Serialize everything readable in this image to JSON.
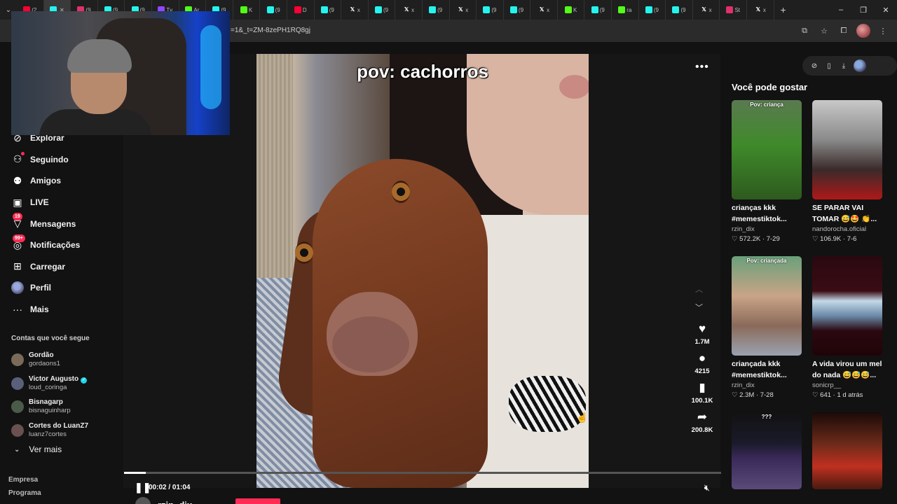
{
  "browser": {
    "tabs": [
      {
        "icon": "youtube-icon",
        "text": "(2",
        "color": "#ff0033"
      },
      {
        "icon": "tiktok-icon",
        "text": "",
        "color": "#25f4ee",
        "active": true,
        "close": "✕"
      },
      {
        "icon": "instagram-icon",
        "text": "(9",
        "color": "#e1306c"
      },
      {
        "icon": "tiktok-icon",
        "text": "(9",
        "color": "#25f4ee"
      },
      {
        "icon": "tiktok-icon",
        "text": "(9",
        "color": "#25f4ee"
      },
      {
        "icon": "twitch-icon",
        "text": "Tv",
        "color": "#9146ff"
      },
      {
        "icon": "kick-icon",
        "text": "Ar",
        "color": "#53fc18"
      },
      {
        "icon": "tiktok-icon",
        "text": "(9",
        "color": "#25f4ee"
      },
      {
        "icon": "kick-icon",
        "text": "K",
        "color": "#53fc18"
      },
      {
        "icon": "tiktok-icon",
        "text": "(9",
        "color": "#25f4ee"
      },
      {
        "icon": "youtube-icon",
        "text": "D",
        "color": "#ff0033"
      },
      {
        "icon": "tiktok-icon",
        "text": "(9",
        "color": "#25f4ee"
      },
      {
        "icon": "x-icon",
        "text": "x",
        "color": "#ffffff"
      },
      {
        "icon": "tiktok-icon",
        "text": "(9",
        "color": "#25f4ee"
      },
      {
        "icon": "x-icon",
        "text": "x",
        "color": "#ffffff"
      },
      {
        "icon": "tiktok-icon",
        "text": "(9",
        "color": "#25f4ee"
      },
      {
        "icon": "x-icon",
        "text": "x",
        "color": "#ffffff"
      },
      {
        "icon": "tiktok-icon",
        "text": "(9",
        "color": "#25f4ee"
      },
      {
        "icon": "tiktok-icon",
        "text": "(9",
        "color": "#25f4ee"
      },
      {
        "icon": "x-icon",
        "text": "x",
        "color": "#ffffff"
      },
      {
        "icon": "kick-icon",
        "text": "K",
        "color": "#53fc18"
      },
      {
        "icon": "tiktok-icon",
        "text": "(9",
        "color": "#25f4ee"
      },
      {
        "icon": "kick-icon",
        "text": "ra",
        "color": "#53fc18"
      },
      {
        "icon": "tiktok-icon",
        "text": "(9",
        "color": "#25f4ee"
      },
      {
        "icon": "tiktok-icon",
        "text": "(9",
        "color": "#25f4ee"
      },
      {
        "icon": "x-icon",
        "text": "x",
        "color": "#ffffff"
      },
      {
        "icon": "instagram-icon",
        "text": "St",
        "color": "#e1306c"
      },
      {
        "icon": "x-icon",
        "text": "x",
        "color": "#ffffff"
      }
    ],
    "new_tab": "+",
    "window_controls": [
      "–",
      "❐",
      "✕"
    ],
    "url": "=1&_t=ZM-8zePH1RQ8gj",
    "addr_icons": [
      "⧉",
      "☆",
      "⧠",
      "",
      "⋮"
    ]
  },
  "sidebar": {
    "nav": [
      {
        "name": "explorar",
        "icon": "compass-icon",
        "glyph": "⊘",
        "label": "Explorar"
      },
      {
        "name": "seguindo",
        "icon": "following-icon",
        "glyph": "⚇",
        "label": "Seguindo",
        "dot": true
      },
      {
        "name": "amigos",
        "icon": "friends-icon",
        "glyph": "⚉",
        "label": "Amigos"
      },
      {
        "name": "live",
        "icon": "live-icon",
        "glyph": "▣",
        "label": "LIVE"
      },
      {
        "name": "mensagens",
        "icon": "messages-icon",
        "glyph": "▽",
        "label": "Mensagens",
        "badge": "19"
      },
      {
        "name": "notificacoes",
        "icon": "notifications-icon",
        "glyph": "◎",
        "label": "Notificações",
        "badge": "99+"
      },
      {
        "name": "carregar",
        "icon": "upload-icon",
        "glyph": "⊞",
        "label": "Carregar"
      },
      {
        "name": "perfil",
        "icon": "profile-icon",
        "glyph": "",
        "label": "Perfil",
        "avatar": true
      },
      {
        "name": "mais",
        "icon": "more-icon",
        "glyph": "···",
        "label": "Mais"
      }
    ],
    "following_title": "Contas que você segue",
    "following": [
      {
        "name": "Gordão",
        "user": "gordaons1",
        "verified": false,
        "color": "#7b6a5a"
      },
      {
        "name": "Victor Augusto",
        "user": "loud_coringa",
        "verified": true,
        "color": "#5a5f7a"
      },
      {
        "name": "Bisnagarp",
        "user": "bisnaguinharp",
        "verified": false,
        "color": "#4b5b4a"
      },
      {
        "name": "Cortes do LuanZ7",
        "user": "luanz7cortes",
        "verified": false,
        "color": "#6a5050"
      }
    ],
    "see_more": "Ver mais",
    "footer": [
      "Empresa",
      "Programa"
    ]
  },
  "player": {
    "caption": "pov: cachorros",
    "more": "•••",
    "prev": "︿",
    "next": "﹀",
    "actions": [
      {
        "name": "like",
        "icon": "heart-icon",
        "glyph": "♥",
        "count": "1.7M"
      },
      {
        "name": "comment",
        "icon": "comment-icon",
        "glyph": "●",
        "count": "4215"
      },
      {
        "name": "save",
        "icon": "bookmark-icon",
        "glyph": "▮",
        "count": "100.1K"
      },
      {
        "name": "share",
        "icon": "share-icon",
        "glyph": "➦",
        "count": "200.8K"
      }
    ],
    "progress": 0.036,
    "time": "00:02 / 01:04",
    "play_glyph": "❚❚",
    "mute_glyph": "🔇︎",
    "author": "rzin_dix"
  },
  "right": {
    "icons": [
      "⊘",
      "▯",
      "⤓"
    ],
    "title": "Você pode gostar",
    "cards": [
      {
        "label": "Pov: criança",
        "title": "crianças kkk #memestiktok...",
        "user": "rzin_dix",
        "stats": "♡ 572.2K · 7-29",
        "bg": "linear-gradient(180deg,#5a7a50 0%,#3f8a2a 45%,#2d5a1e 100%)"
      },
      {
        "label": "",
        "title": "SE PARAR VAI TOMAR 😅🤩 👏...",
        "user": "nandorocha.oficial",
        "stats": "♡ 106.9K · 7-6",
        "bg": "linear-gradient(180deg,#c8c8c8 0%,#8a8a8a 40%,#3a2a2a 70%,#b01818 100%)"
      },
      {
        "label": "Pov: criançada",
        "title": "criançada kkk #memestiktok...",
        "user": "rzin_dix",
        "stats": "♡ 2.3M · 7-28",
        "bg": "linear-gradient(180deg,#6aa07a 0%,#c9a487 40%,#8a6a5a 70%,#9aa3b0 100%)"
      },
      {
        "label": "",
        "title": "A vida virou um mel do nada 😅😅😅...",
        "user": "sonicrp__",
        "stats": "♡ 641 · 1 d atrás",
        "bg": "linear-gradient(180deg,#2a0810 0%,#3a0c14 35%,#c4d8e8 45%,#6a8aa8 60%,#2a0810 75%,#200408 100%)"
      },
      {
        "label": "???",
        "title": "",
        "user": "",
        "stats": "",
        "bg": "linear-gradient(180deg,#121212 0%,#1a1a2a 40%,#3a2a5a 60%,#5a4a7a 100%)"
      },
      {
        "label": "",
        "title": "",
        "user": "",
        "stats": "",
        "bg": "linear-gradient(180deg,#1a0a08 0%,#6a2a1a 40%,#c03020 70%,#4a1a10 100%)"
      }
    ]
  }
}
